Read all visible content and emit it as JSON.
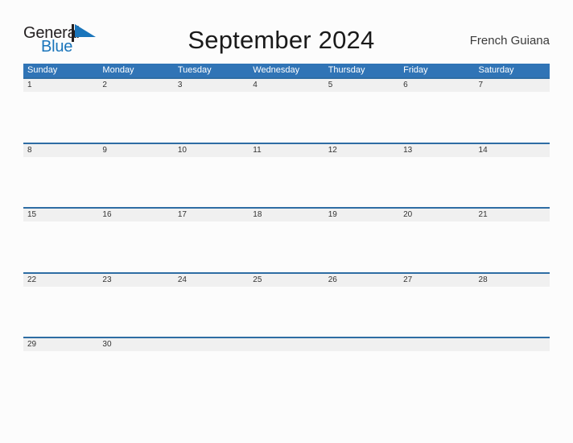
{
  "brand": {
    "name_top": "General",
    "name_bottom": "Blue",
    "flag_icon": "blue-flag-icon",
    "color_dark": "#231f20",
    "color_blue": "#1a75bb"
  },
  "header": {
    "title": "September 2024",
    "locale": "French Guiana"
  },
  "colors": {
    "header_blue": "#3074b6",
    "row_rule_blue": "#2e6da4",
    "band_gray": "#f0f0f0",
    "page_background": "#fcfcfc",
    "text_dark": "#333333"
  },
  "calendar": {
    "month": "September",
    "year": "2024",
    "weekday_headers": [
      "Sunday",
      "Monday",
      "Tuesday",
      "Wednesday",
      "Thursday",
      "Friday",
      "Saturday"
    ],
    "weeks": [
      [
        "1",
        "2",
        "3",
        "4",
        "5",
        "6",
        "7"
      ],
      [
        "8",
        "9",
        "10",
        "11",
        "12",
        "13",
        "14"
      ],
      [
        "15",
        "16",
        "17",
        "18",
        "19",
        "20",
        "21"
      ],
      [
        "22",
        "23",
        "24",
        "25",
        "26",
        "27",
        "28"
      ],
      [
        "29",
        "30",
        "",
        "",
        "",
        "",
        ""
      ]
    ]
  }
}
